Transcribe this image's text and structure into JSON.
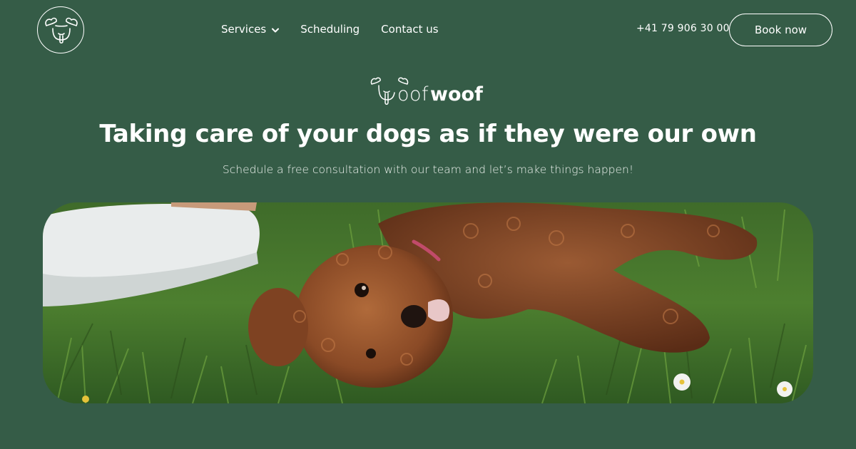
{
  "header": {
    "logo_icon": "dog-face-icon",
    "nav": [
      {
        "label": "Services",
        "has_dropdown": true
      },
      {
        "label": "Scheduling",
        "has_dropdown": false
      },
      {
        "label": "Contact us",
        "has_dropdown": false
      }
    ],
    "phone": "+41 79 906 30 00",
    "cta_label": "Book now"
  },
  "brand": {
    "icon": "dog-face-icon",
    "name_light": "oof",
    "name_bold": "woof"
  },
  "hero": {
    "headline": "Taking care of your dogs as if they were our own",
    "subhead": "Schedule a free consultation with our team and let’s make things happen!"
  },
  "colors": {
    "background": "#355c47",
    "text": "#ffffff"
  }
}
